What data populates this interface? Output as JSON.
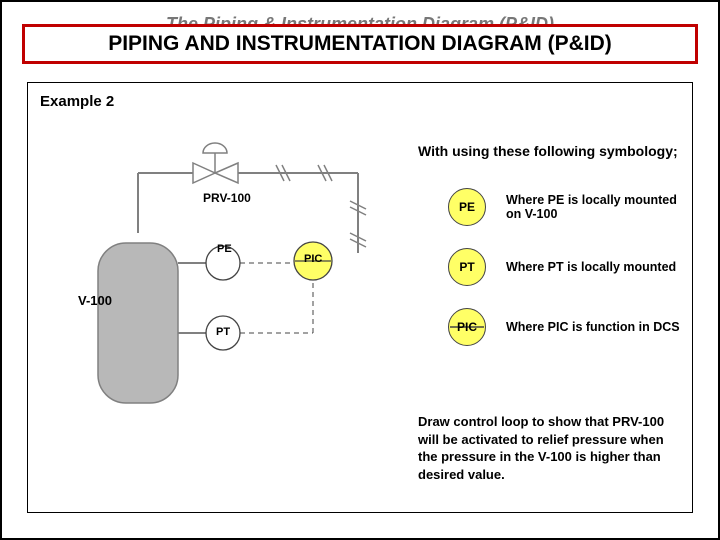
{
  "hidden_title": "The Piping & Instrumentation Diagram (P&ID)",
  "title": "PIPING AND INSTRUMENTATION DIAGRAM (P&ID)",
  "example": "Example 2",
  "symb_intro": "With using these following symbology;",
  "vessel_label": "V-100",
  "valve_label": "PRV-100",
  "pe": "PE",
  "pt": "PT",
  "pic": "PIC",
  "legend": {
    "pe": {
      "code": "PE",
      "text": "Where PE is locally mounted on V-100"
    },
    "pt": {
      "code": "PT",
      "text": "Where PT is locally mounted"
    },
    "pic": {
      "code": "PIC",
      "text": "Where PIC is function in DCS"
    }
  },
  "bottom": "Draw control loop to show that PRV-100 will be activated to relief pressure when the pressure in the V-100 is higher than desired value."
}
